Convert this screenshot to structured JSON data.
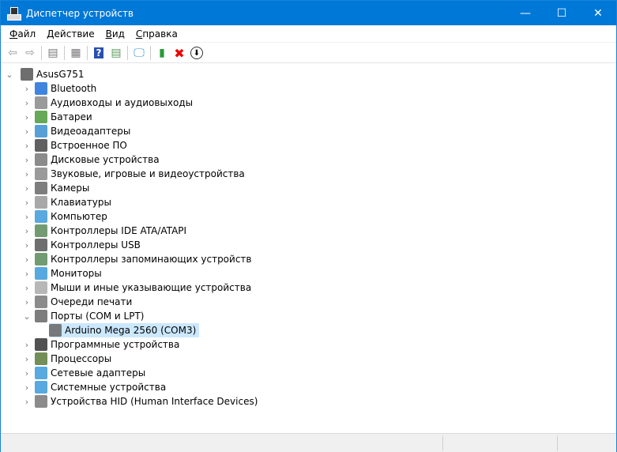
{
  "window": {
    "title": "Диспетчер устройств",
    "minimize": "—",
    "maximize": "☐",
    "close": "✕"
  },
  "menu": [
    {
      "label": "Файл",
      "key": "Ф",
      "rest": "айл"
    },
    {
      "label": "Действие",
      "key": "Д",
      "rest": "ействие"
    },
    {
      "label": "Вид",
      "key": "В",
      "rest": "ид"
    },
    {
      "label": "Справка",
      "key": "С",
      "rest": "правка"
    }
  ],
  "toolbar": [
    "back-icon",
    "forward-icon",
    "console-tree-icon",
    "properties-icon",
    "help-icon",
    "action-pane-icon",
    "scan-hardware-icon",
    "update-driver-icon",
    "uninstall-icon",
    "disable-icon"
  ],
  "tree": {
    "root": "AsusG751",
    "categories": [
      {
        "label": "Bluetooth",
        "icon": "bluetooth-icon",
        "color": "#1e6fd9"
      },
      {
        "label": "Аудиовходы и аудиовыходы",
        "icon": "speaker-icon",
        "color": "#888888"
      },
      {
        "label": "Батареи",
        "icon": "battery-icon",
        "color": "#4a9a3a"
      },
      {
        "label": "Видеоадаптеры",
        "icon": "display-adapter-icon",
        "color": "#3a8fd0"
      },
      {
        "label": "Встроенное ПО",
        "icon": "firmware-icon",
        "color": "#444444"
      },
      {
        "label": "Дисковые устройства",
        "icon": "disk-icon",
        "color": "#777777"
      },
      {
        "label": "Звуковые, игровые и видеоустройства",
        "icon": "sound-icon",
        "color": "#888888"
      },
      {
        "label": "Камеры",
        "icon": "camera-icon",
        "color": "#666666"
      },
      {
        "label": "Клавиатуры",
        "icon": "keyboard-icon",
        "color": "#999999"
      },
      {
        "label": "Компьютер",
        "icon": "computer-icon",
        "color": "#3a9ad9"
      },
      {
        "label": "Контроллеры IDE ATA/ATAPI",
        "icon": "ide-controller-icon",
        "color": "#5a8a5a"
      },
      {
        "label": "Контроллеры USB",
        "icon": "usb-icon",
        "color": "#555555"
      },
      {
        "label": "Контроллеры запоминающих устройств",
        "icon": "storage-controller-icon",
        "color": "#5a8a5a"
      },
      {
        "label": "Мониторы",
        "icon": "monitor-icon",
        "color": "#3a9ad9"
      },
      {
        "label": "Мыши и иные указывающие устройства",
        "icon": "mouse-icon",
        "color": "#aaaaaa"
      },
      {
        "label": "Очереди печати",
        "icon": "printer-icon",
        "color": "#777777"
      },
      {
        "label": "Порты (COM и LPT)",
        "icon": "port-icon",
        "color": "#666666",
        "expanded": true,
        "children": [
          {
            "label": "Arduino Mega 2560 (COM3)",
            "icon": "port-icon",
            "color": "#666666",
            "selected": true
          }
        ]
      },
      {
        "label": "Программные устройства",
        "icon": "software-device-icon",
        "color": "#333333"
      },
      {
        "label": "Процессоры",
        "icon": "processor-icon",
        "color": "#5a7a3a"
      },
      {
        "label": "Сетевые адаптеры",
        "icon": "network-adapter-icon",
        "color": "#3a9ad9"
      },
      {
        "label": "Системные устройства",
        "icon": "system-device-icon",
        "color": "#3a9ad9"
      },
      {
        "label": "Устройства HID (Human Interface Devices)",
        "icon": "hid-icon",
        "color": "#777777"
      }
    ]
  }
}
